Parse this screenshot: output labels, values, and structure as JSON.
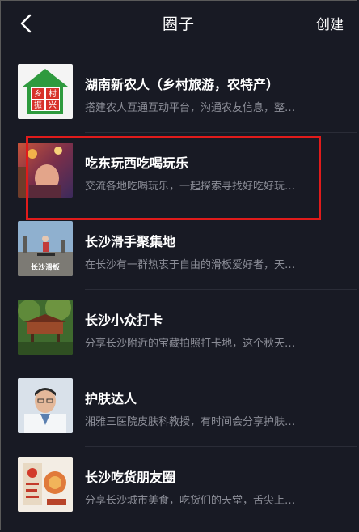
{
  "header": {
    "back_icon": "chevron-left-icon",
    "title": "圈子",
    "create_label": "创建"
  },
  "circles": [
    {
      "name": "湖南新农人（乡村旅游，农特产）",
      "desc": "搭建农人互通互动平台，沟通农友信息，整…",
      "thumb_text": [
        "乡",
        "村",
        "振",
        "兴"
      ]
    },
    {
      "name": "吃东玩西吃喝玩乐",
      "desc": "交流各地吃喝玩乐，一起探索寻找好吃好玩…"
    },
    {
      "name": "长沙滑手聚集地",
      "desc": "在长沙有一群热衷于自由的滑板爱好者，天…",
      "thumb_text": [
        "长沙滑板"
      ]
    },
    {
      "name": "长沙小众打卡",
      "desc": "分享长沙附近的宝藏拍照打卡地，这个秋天…"
    },
    {
      "name": "护肤达人",
      "desc": "湘雅三医院皮肤科教授，有时间会分享护肤…"
    },
    {
      "name": "长沙吃货朋友圈",
      "desc": "分享长沙城市美食，吃货们的天堂，舌尖上…"
    }
  ],
  "highlight_color": "#e01b1b"
}
